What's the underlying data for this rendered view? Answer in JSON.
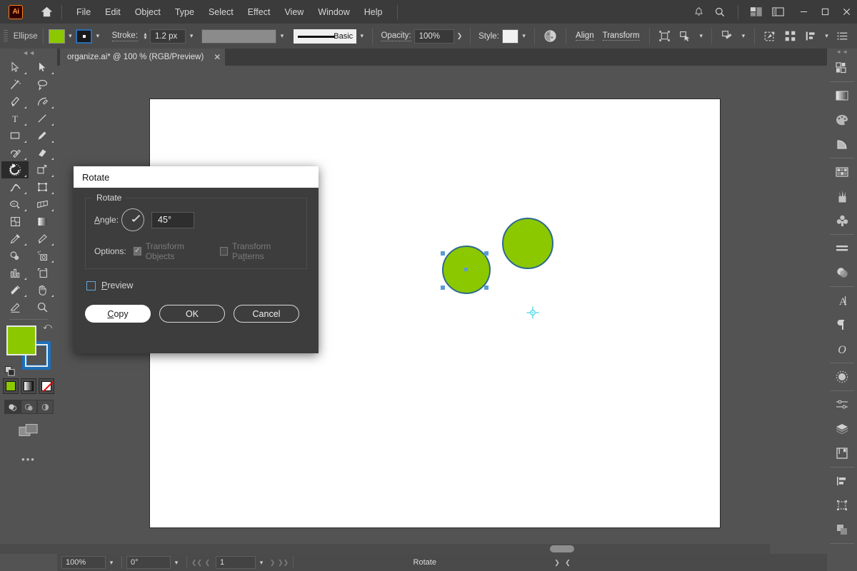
{
  "app": {
    "logo_text": "Ai",
    "home_icon": "home-icon",
    "notification_icon": "bell-icon",
    "search_icon": "search-icon",
    "arrange_icon": "arrange-documents-icon",
    "workspace_icon": "workspace-switcher-icon",
    "minimize_label": "—",
    "maximize_label": "❐",
    "close_label": "✕"
  },
  "menu": {
    "items": [
      {
        "label": "File"
      },
      {
        "label": "Edit"
      },
      {
        "label": "Object"
      },
      {
        "label": "Type"
      },
      {
        "label": "Select"
      },
      {
        "label": "Effect"
      },
      {
        "label": "View"
      },
      {
        "label": "Window"
      },
      {
        "label": "Help"
      }
    ]
  },
  "control_bar": {
    "tool_name": "Ellipse",
    "fill_color": "#8cc800",
    "stroke_swatch_label": "stroke-swatch",
    "stroke_label": "Stroke:",
    "stroke_weight": "1.2 px",
    "brush_definition": "",
    "style_profile_label": "Basic",
    "opacity_label": "Opacity:",
    "opacity_value": "100%",
    "opacity_more": "❯",
    "style_label": "Style:",
    "recolor_icon": "recolor-artwork-icon",
    "align_label": "Align",
    "transform_label": "Transform",
    "isolate_icon": "isolate-selected-object-icon",
    "mask_icon": "edit-clipping-mask-icon",
    "shape_icon": "shape-builder-icon",
    "select_similar_icon": "select-similar-icon",
    "distribute_icon": "distribute-spacing-icon",
    "arrange_icon": "arrange-order-icon",
    "document_setup_icon": "document-setup-icon"
  },
  "document": {
    "tab_title": "organize.ai* @ 100 % (RGB/Preview)",
    "close_icon": "✕"
  },
  "toolbar": {
    "grip_icon": "panel-grip-icon",
    "tools": [
      {
        "name": "selection-tool",
        "selected": false,
        "has_submenu": true
      },
      {
        "name": "direct-selection-tool",
        "selected": false,
        "has_submenu": true
      },
      {
        "name": "magic-wand-tool",
        "selected": false,
        "has_submenu": false
      },
      {
        "name": "lasso-tool",
        "selected": false,
        "has_submenu": false
      },
      {
        "name": "pen-tool",
        "selected": false,
        "has_submenu": true
      },
      {
        "name": "curvature-tool",
        "selected": false,
        "has_submenu": false
      },
      {
        "name": "type-tool",
        "selected": false,
        "has_submenu": true
      },
      {
        "name": "line-segment-tool",
        "selected": false,
        "has_submenu": true
      },
      {
        "name": "rectangle-tool",
        "selected": false,
        "has_submenu": true
      },
      {
        "name": "paintbrush-tool",
        "selected": false,
        "has_submenu": true
      },
      {
        "name": "shaper-tool",
        "selected": false,
        "has_submenu": true
      },
      {
        "name": "eraser-tool",
        "selected": false,
        "has_submenu": true
      },
      {
        "name": "rotate-tool",
        "selected": true,
        "has_submenu": true
      },
      {
        "name": "scale-tool",
        "selected": false,
        "has_submenu": true
      },
      {
        "name": "width-tool",
        "selected": false,
        "has_submenu": true
      },
      {
        "name": "free-transform-tool",
        "selected": false,
        "has_submenu": false
      },
      {
        "name": "shape-builder-tool",
        "selected": false,
        "has_submenu": true
      },
      {
        "name": "perspective-grid-tool",
        "selected": false,
        "has_submenu": true
      },
      {
        "name": "mesh-tool",
        "selected": false,
        "has_submenu": false
      },
      {
        "name": "gradient-tool",
        "selected": false,
        "has_submenu": false
      },
      {
        "name": "eyedropper-tool",
        "selected": false,
        "has_submenu": true
      },
      {
        "name": "measure-tool",
        "selected": false,
        "has_submenu": true
      },
      {
        "name": "blend-tool",
        "selected": false,
        "has_submenu": false
      },
      {
        "name": "symbol-sprayer-tool",
        "selected": false,
        "has_submenu": true
      },
      {
        "name": "column-graph-tool",
        "selected": false,
        "has_submenu": true
      },
      {
        "name": "artboard-tool",
        "selected": false,
        "has_submenu": false
      },
      {
        "name": "slice-tool",
        "selected": false,
        "has_submenu": true
      },
      {
        "name": "hand-tool",
        "selected": false,
        "has_submenu": true
      },
      {
        "name": "print-tiling-tool",
        "selected": false,
        "has_submenu": false
      },
      {
        "name": "zoom-tool",
        "selected": false,
        "has_submenu": false
      }
    ],
    "fill_color": "#8cc800",
    "stroke_color": "#1d6fb8",
    "swap_icon": "swap-fill-stroke-icon",
    "default_icon": "default-fill-stroke-icon",
    "modes": [
      {
        "name": "color-mode",
        "selected": true
      },
      {
        "name": "gradient-mode",
        "selected": false
      },
      {
        "name": "none-mode",
        "selected": false
      }
    ],
    "draw_modes": [
      {
        "name": "draw-normal",
        "selected": true
      },
      {
        "name": "draw-behind",
        "selected": false
      },
      {
        "name": "draw-inside",
        "selected": false
      }
    ],
    "screen_mode_icon": "change-screen-mode-icon",
    "more_tools": "•••"
  },
  "canvas": {
    "shapes": [
      {
        "name": "circle-unselected",
        "fill": "#8cc800",
        "stroke": "#2d6a8e"
      },
      {
        "name": "circle-selected",
        "fill": "#8cc800",
        "stroke": "#2d6a8e",
        "selected": true
      }
    ],
    "reference_point": "rotate-reference-point"
  },
  "right_panel": {
    "groups": [
      {
        "icons": [
          {
            "name": "properties-panel-icon"
          }
        ]
      },
      {
        "icons": [
          {
            "name": "gradient-panel-icon"
          },
          {
            "name": "color-panel-icon"
          },
          {
            "name": "color-guide-panel-icon"
          }
        ]
      },
      {
        "icons": [
          {
            "name": "swatches-panel-icon"
          },
          {
            "name": "brushes-panel-icon"
          },
          {
            "name": "symbols-panel-icon"
          }
        ]
      },
      {
        "icons": [
          {
            "name": "stroke-panel-icon"
          },
          {
            "name": "transparency-panel-icon"
          }
        ]
      },
      {
        "icons": [
          {
            "name": "character-panel-icon"
          },
          {
            "name": "paragraph-panel-icon"
          },
          {
            "name": "opentype-panel-icon"
          }
        ]
      },
      {
        "icons": [
          {
            "name": "appearance-panel-icon"
          }
        ]
      },
      {
        "icons": [
          {
            "name": "transform-panel-icon"
          },
          {
            "name": "layers-panel-icon"
          },
          {
            "name": "artboards-panel-icon"
          }
        ]
      },
      {
        "icons": [
          {
            "name": "align-panel-icon"
          },
          {
            "name": "pathfinder-panel-icon"
          },
          {
            "name": "libraries-panel-icon"
          }
        ]
      }
    ]
  },
  "dialog": {
    "title": "Rotate",
    "group_label": "Rotate",
    "angle_label": "Angle:",
    "angle_value": "45°",
    "angle_dial": "angle-dial",
    "options_label": "Options:",
    "transform_objects_label": "Transform Objects",
    "transform_objects_checked": true,
    "transform_objects_enabled": false,
    "transform_patterns_label": "Transform Patterns",
    "transform_patterns_checked": false,
    "transform_patterns_enabled": false,
    "preview_label": "Preview",
    "preview_checked": false,
    "copy_label": "Copy",
    "ok_label": "OK",
    "cancel_label": "Cancel"
  },
  "status_bar": {
    "zoom_value": "100%",
    "rotation_value": "0°",
    "page_value": "1",
    "status_text": "Rotate",
    "first_icon": "❮❮",
    "prev_icon": "❮",
    "next_icon": "❯",
    "last_icon": "❯❯",
    "expand_icon": "❯",
    "collapse_icon": "❮"
  }
}
